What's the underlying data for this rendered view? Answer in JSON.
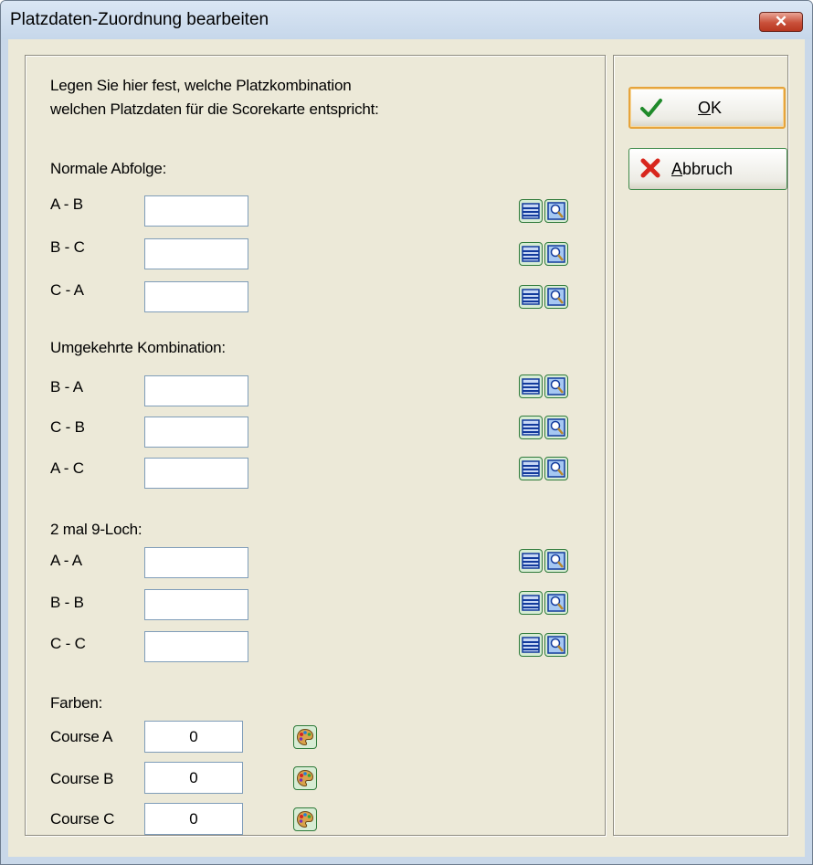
{
  "window": {
    "title": "Platzdaten-Zuordnung bearbeiten"
  },
  "intro": {
    "line1": "Legen Sie hier fest, welche Platzkombination",
    "line2": "welchen Platzdaten für die Scorekarte entspricht:"
  },
  "sections": {
    "normal": {
      "title": "Normale Abfolge:",
      "rows": [
        {
          "label": "A - B",
          "value": ""
        },
        {
          "label": "B - C",
          "value": ""
        },
        {
          "label": "C - A",
          "value": ""
        }
      ]
    },
    "reverse": {
      "title": "Umgekehrte Kombination:",
      "rows": [
        {
          "label": "B - A",
          "value": ""
        },
        {
          "label": "C - B",
          "value": ""
        },
        {
          "label": "A - C",
          "value": ""
        }
      ]
    },
    "nine": {
      "title": "2 mal 9-Loch:",
      "rows": [
        {
          "label": "A - A",
          "value": ""
        },
        {
          "label": "B - B",
          "value": ""
        },
        {
          "label": "C - C",
          "value": ""
        }
      ]
    }
  },
  "colors": {
    "title": "Farben:",
    "rows": [
      {
        "label": "Course A",
        "value": "0"
      },
      {
        "label": "Course B",
        "value": "0"
      },
      {
        "label": "Course C",
        "value": "0"
      }
    ]
  },
  "buttons": {
    "ok": "OK",
    "ok_mnemonic": "O",
    "cancel": "Abbruch",
    "cancel_mnemonic": "A"
  },
  "icons": {
    "close": "close-icon",
    "database": "database-icon",
    "search": "magnifier-icon",
    "palette": "palette-icon",
    "check": "checkmark-icon",
    "cancel": "red-x-icon"
  },
  "accents": {
    "titlebar": "#c9d8e9",
    "client_bg": "#ece9d8",
    "close_red": "#c9503a",
    "button_green": "#3e8a4a",
    "default_orange": "#e6a43c"
  }
}
